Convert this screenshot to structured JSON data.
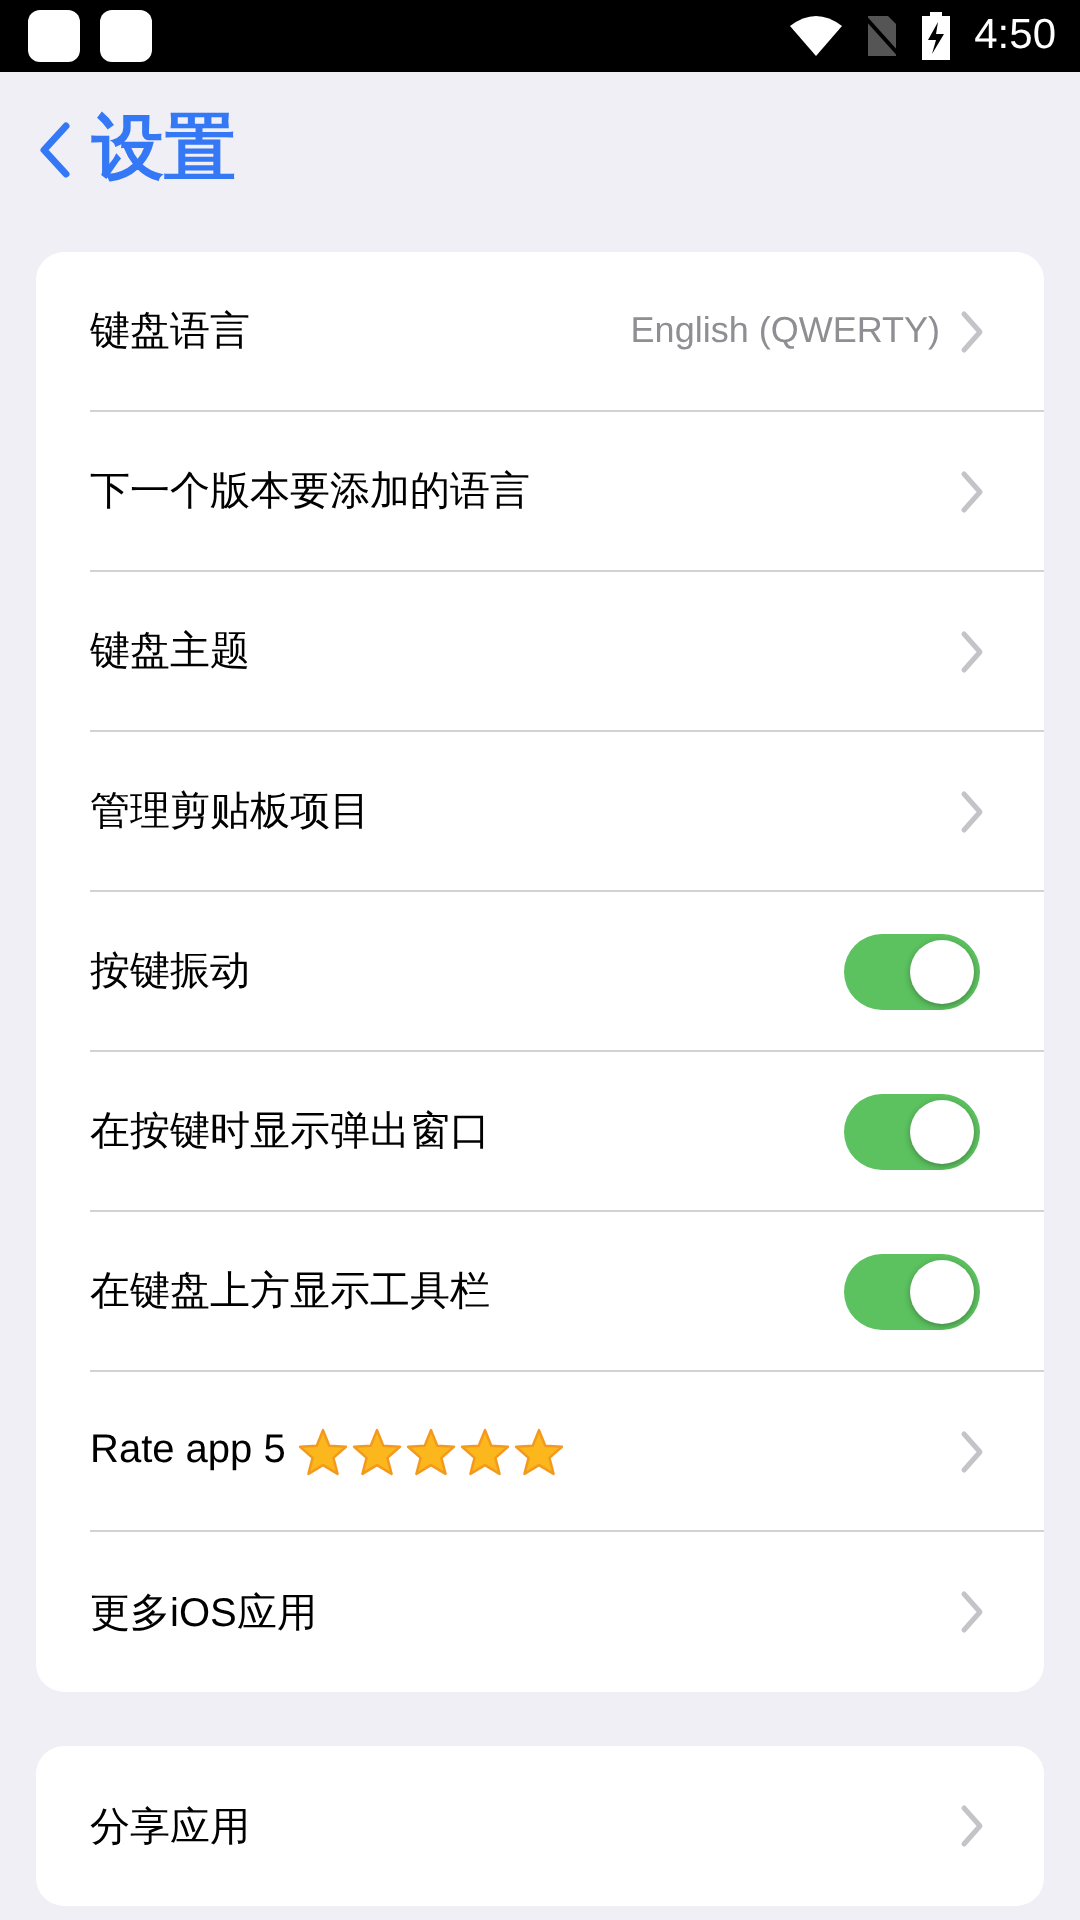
{
  "status_bar": {
    "time": "4:50"
  },
  "header": {
    "title": "设置"
  },
  "sections": [
    {
      "rows": [
        {
          "kind": "link",
          "label": "键盘语言",
          "value": "English (QWERTY)"
        },
        {
          "kind": "link",
          "label": "下一个版本要添加的语言"
        },
        {
          "kind": "link",
          "label": "键盘主题"
        },
        {
          "kind": "link",
          "label": "管理剪贴板项目"
        },
        {
          "kind": "toggle",
          "label": "按键振动",
          "on": true
        },
        {
          "kind": "toggle",
          "label": "在按键时显示弹出窗口",
          "on": true
        },
        {
          "kind": "toggle",
          "label": "在键盘上方显示工具栏",
          "on": true
        },
        {
          "kind": "rating",
          "label": "Rate app 5",
          "stars": 5
        },
        {
          "kind": "link",
          "label": "更多iOS应用"
        }
      ]
    },
    {
      "rows": [
        {
          "kind": "link",
          "label": "分享应用"
        }
      ]
    }
  ]
}
